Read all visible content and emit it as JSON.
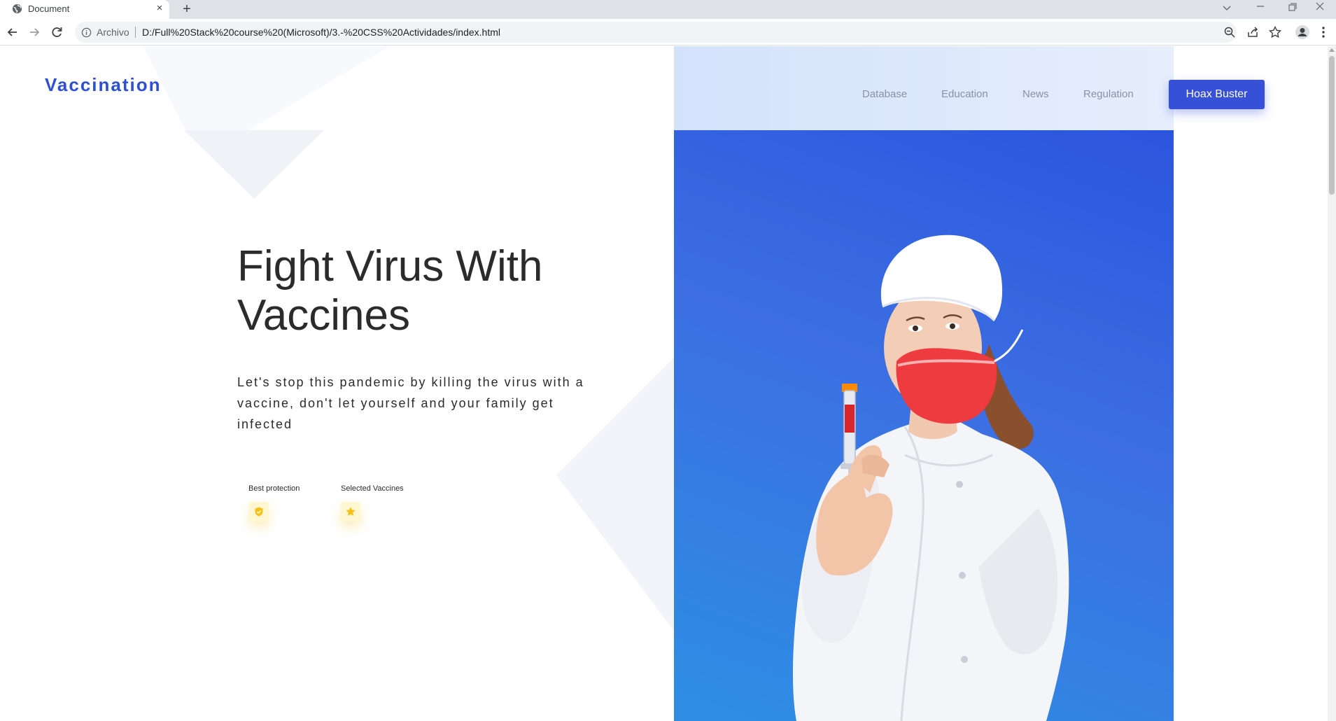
{
  "browser": {
    "tab_title": "Document",
    "tab_close": "×",
    "new_tab": "+",
    "address_scheme": "Archivo",
    "address_url": "D:/Full%20Stack%20course%20(Microsoft)/3.-%20CSS%20Actividades/index.html"
  },
  "site": {
    "brand": "Vaccination",
    "nav": [
      "Database",
      "Education",
      "News",
      "Regulation"
    ],
    "cta_label": "Hoax Buster"
  },
  "hero": {
    "title": "Fight Virus With Vaccines",
    "subtitle": "Let's stop this pandemic by killing the virus with a vaccine, don't let yourself and your family get infected"
  },
  "features": [
    {
      "label": "Best protection",
      "icon": "shield-check-icon"
    },
    {
      "label": "Selected Vaccines",
      "icon": "star-icon"
    }
  ],
  "colors": {
    "brand": "#2d4fd4",
    "cta": "#3650d7",
    "nav_text": "#8a90a8",
    "feature_icon": "#f5c116",
    "hero_image_bg": "#2f5fe0"
  }
}
